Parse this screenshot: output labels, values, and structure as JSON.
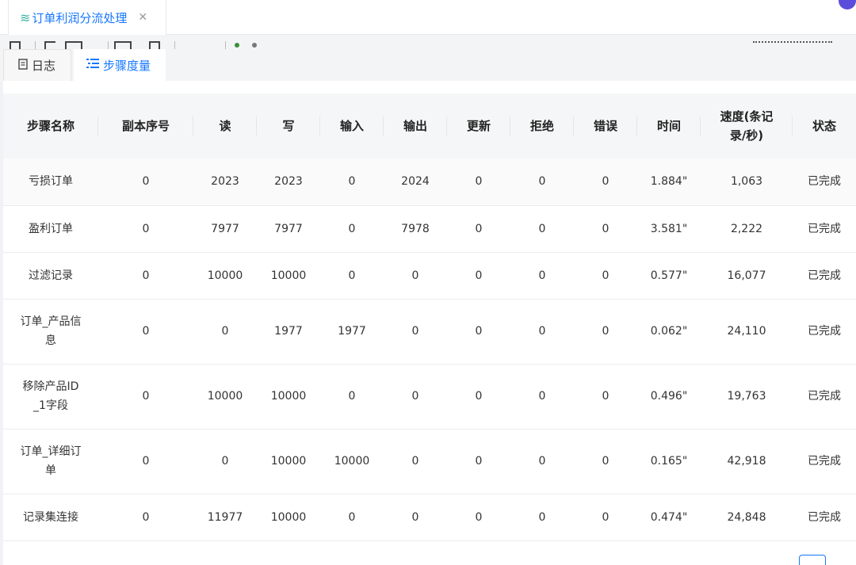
{
  "doc_tab": {
    "title": "订单利润分流处理",
    "close": "✕"
  },
  "subtabs": {
    "log": "日志",
    "metrics": "步骤度量"
  },
  "table": {
    "headers": [
      "步骤名称",
      "副本序号",
      "读",
      "写",
      "输入",
      "输出",
      "更新",
      "拒绝",
      "错误",
      "时间",
      "速度(条记录/秒)",
      "状态"
    ],
    "rows": [
      [
        "亏损订单",
        "0",
        "2023",
        "2023",
        "0",
        "2024",
        "0",
        "0",
        "0",
        "1.884\"",
        "1,063",
        "已完成"
      ],
      [
        "盈利订单",
        "0",
        "7977",
        "7977",
        "0",
        "7978",
        "0",
        "0",
        "0",
        "3.581\"",
        "2,222",
        "已完成"
      ],
      [
        "过滤记录",
        "0",
        "10000",
        "10000",
        "0",
        "0",
        "0",
        "0",
        "0",
        "0.577\"",
        "16,077",
        "已完成"
      ],
      [
        "订单_产品信息",
        "0",
        "0",
        "1977",
        "1977",
        "0",
        "0",
        "0",
        "0",
        "0.062\"",
        "24,110",
        "已完成"
      ],
      [
        "移除产品ID_1字段",
        "0",
        "10000",
        "10000",
        "0",
        "0",
        "0",
        "0",
        "0",
        "0.496\"",
        "19,763",
        "已完成"
      ],
      [
        "订单_详细订单",
        "0",
        "0",
        "10000",
        "10000",
        "0",
        "0",
        "0",
        "0",
        "0.165\"",
        "42,918",
        "已完成"
      ],
      [
        "记录集连接",
        "0",
        "11977",
        "10000",
        "0",
        "0",
        "0",
        "0",
        "0",
        "0.474\"",
        "24,848",
        "已完成"
      ]
    ]
  }
}
